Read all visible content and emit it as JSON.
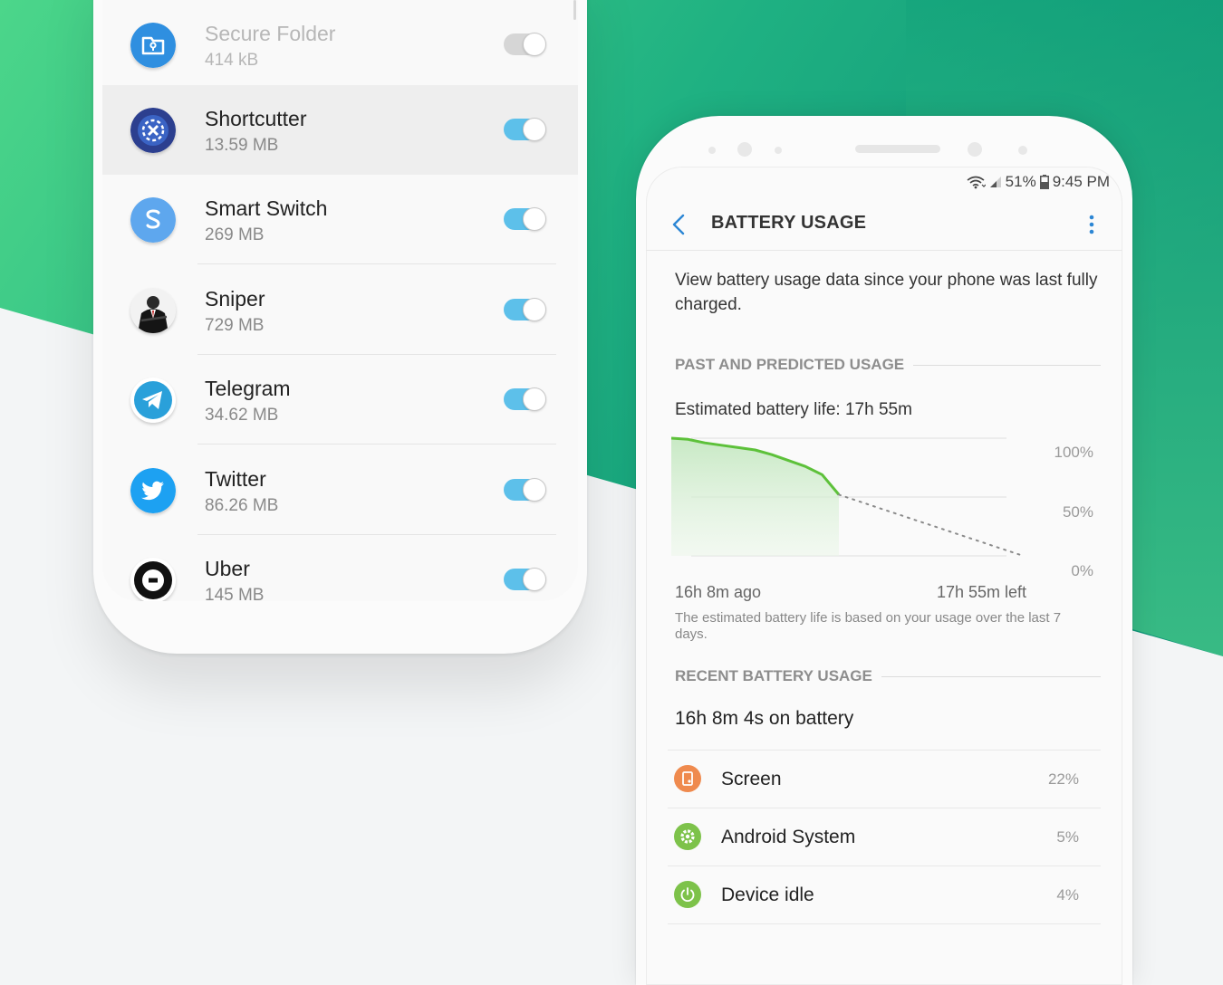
{
  "colors": {
    "accent_green": "#27ae7a",
    "accent_green_light": "#55d88b",
    "toggle_on": "#5dc0ea",
    "toggle_off": "#d6d6d6",
    "chart_line": "#5dc13a"
  },
  "left_phone": {
    "apps": [
      {
        "name": "Secure Folder",
        "size": "414 kB",
        "enabled": false,
        "icon": "secure-folder-icon"
      },
      {
        "name": "Shortcutter",
        "size": "13.59 MB",
        "enabled": true,
        "icon": "shortcutter-icon",
        "highlighted": true
      },
      {
        "name": "Smart Switch",
        "size": "269 MB",
        "enabled": true,
        "icon": "smart-switch-icon"
      },
      {
        "name": "Sniper",
        "size": "729 MB",
        "enabled": true,
        "icon": "sniper-icon"
      },
      {
        "name": "Telegram",
        "size": "34.62 MB",
        "enabled": true,
        "icon": "telegram-icon"
      },
      {
        "name": "Twitter",
        "size": "86.26 MB",
        "enabled": true,
        "icon": "twitter-icon"
      },
      {
        "name": "Uber",
        "size": "145 MB",
        "enabled": true,
        "icon": "uber-icon"
      }
    ]
  },
  "right_phone": {
    "status_bar": {
      "battery": "51%",
      "time": "9:45 PM"
    },
    "app_bar": {
      "title": "BATTERY USAGE"
    },
    "intro": "View battery usage data since your phone was last fully charged.",
    "past_section": {
      "header": "PAST AND PREDICTED USAGE",
      "estimated_life": "Estimated battery life: 17h 55m",
      "x_start_label": "16h 8m ago",
      "x_end_label": "17h 55m left",
      "note": "The estimated battery life is based on your usage over the last 7 days."
    },
    "recent_section": {
      "header": "RECENT BATTERY USAGE",
      "on_battery": "16h 8m 4s on battery",
      "items": [
        {
          "name": "Screen",
          "percent": "22%",
          "icon": "screen-icon",
          "color": "#ef8a4e"
        },
        {
          "name": "Android System",
          "percent": "5%",
          "icon": "android-system-icon",
          "color": "#7dc24a"
        },
        {
          "name": "Device idle",
          "percent": "4%",
          "icon": "device-idle-icon",
          "color": "#7dc24a"
        }
      ]
    }
  },
  "chart_data": {
    "type": "line",
    "y_ticks": [
      "100%",
      "50%",
      "0%"
    ],
    "ylim": [
      0,
      100
    ],
    "grid": true,
    "series": [
      {
        "values": [
          100,
          99,
          96,
          94,
          92,
          90,
          86,
          81,
          76,
          69,
          52
        ],
        "x": [
          0,
          0.1,
          0.2,
          0.3,
          0.4,
          0.5,
          0.6,
          0.7,
          0.8,
          0.9,
          1.0
        ]
      },
      {
        "values": [
          52,
          0
        ],
        "x": [
          1.0,
          2.1
        ]
      }
    ]
  }
}
